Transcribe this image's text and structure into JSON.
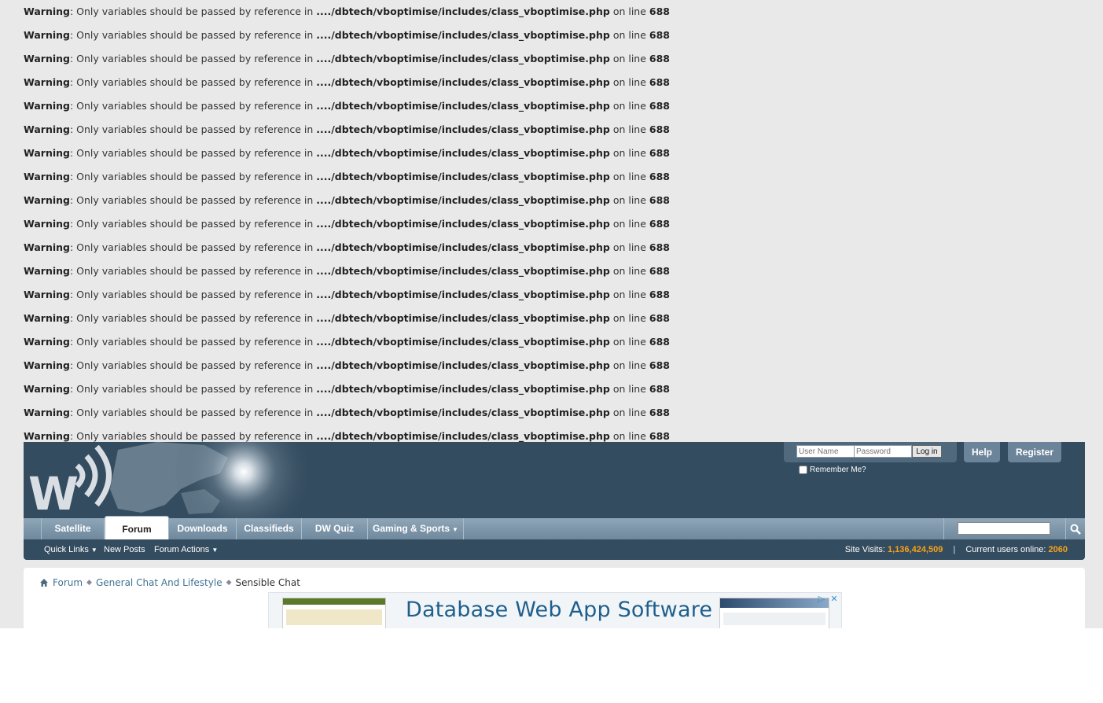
{
  "warnings": {
    "label": "Warning",
    "message": ": Only variables should be passed by reference in ",
    "path": "..../dbtech/vboptimise/includes/class_vboptimise.php",
    "on_line": " on line ",
    "line": "688",
    "count": 19
  },
  "login": {
    "username_placeholder": "User Name",
    "password_placeholder": "Password",
    "login_label": "Log in",
    "remember_label": "Remember Me?"
  },
  "header": {
    "help_label": "Help",
    "register_label": "Register"
  },
  "nav": {
    "tabs": [
      {
        "label": "Satellite"
      },
      {
        "label": "Forum"
      },
      {
        "label": "Downloads"
      },
      {
        "label": "Classifieds"
      },
      {
        "label": "DW Quiz"
      },
      {
        "label": "Gaming & Sports"
      }
    ]
  },
  "subnav": {
    "quick_links": "Quick Links",
    "new_posts": "New Posts",
    "forum_actions": "Forum Actions",
    "site_visits_label": "Site Visits:",
    "site_visits_value": "1,136,424,509",
    "users_online_label": "Current users online:",
    "users_online_value": "2060"
  },
  "breadcrumb": {
    "items": [
      "Forum",
      "General Chat And Lifestyle",
      "Sensible Chat"
    ]
  },
  "ad": {
    "title": "Database Web App Software"
  },
  "colors": {
    "header_bg": "#344c5f",
    "nav_bg": "#7f97aa",
    "accent_orange": "#f7a11a",
    "link": "#417394"
  }
}
